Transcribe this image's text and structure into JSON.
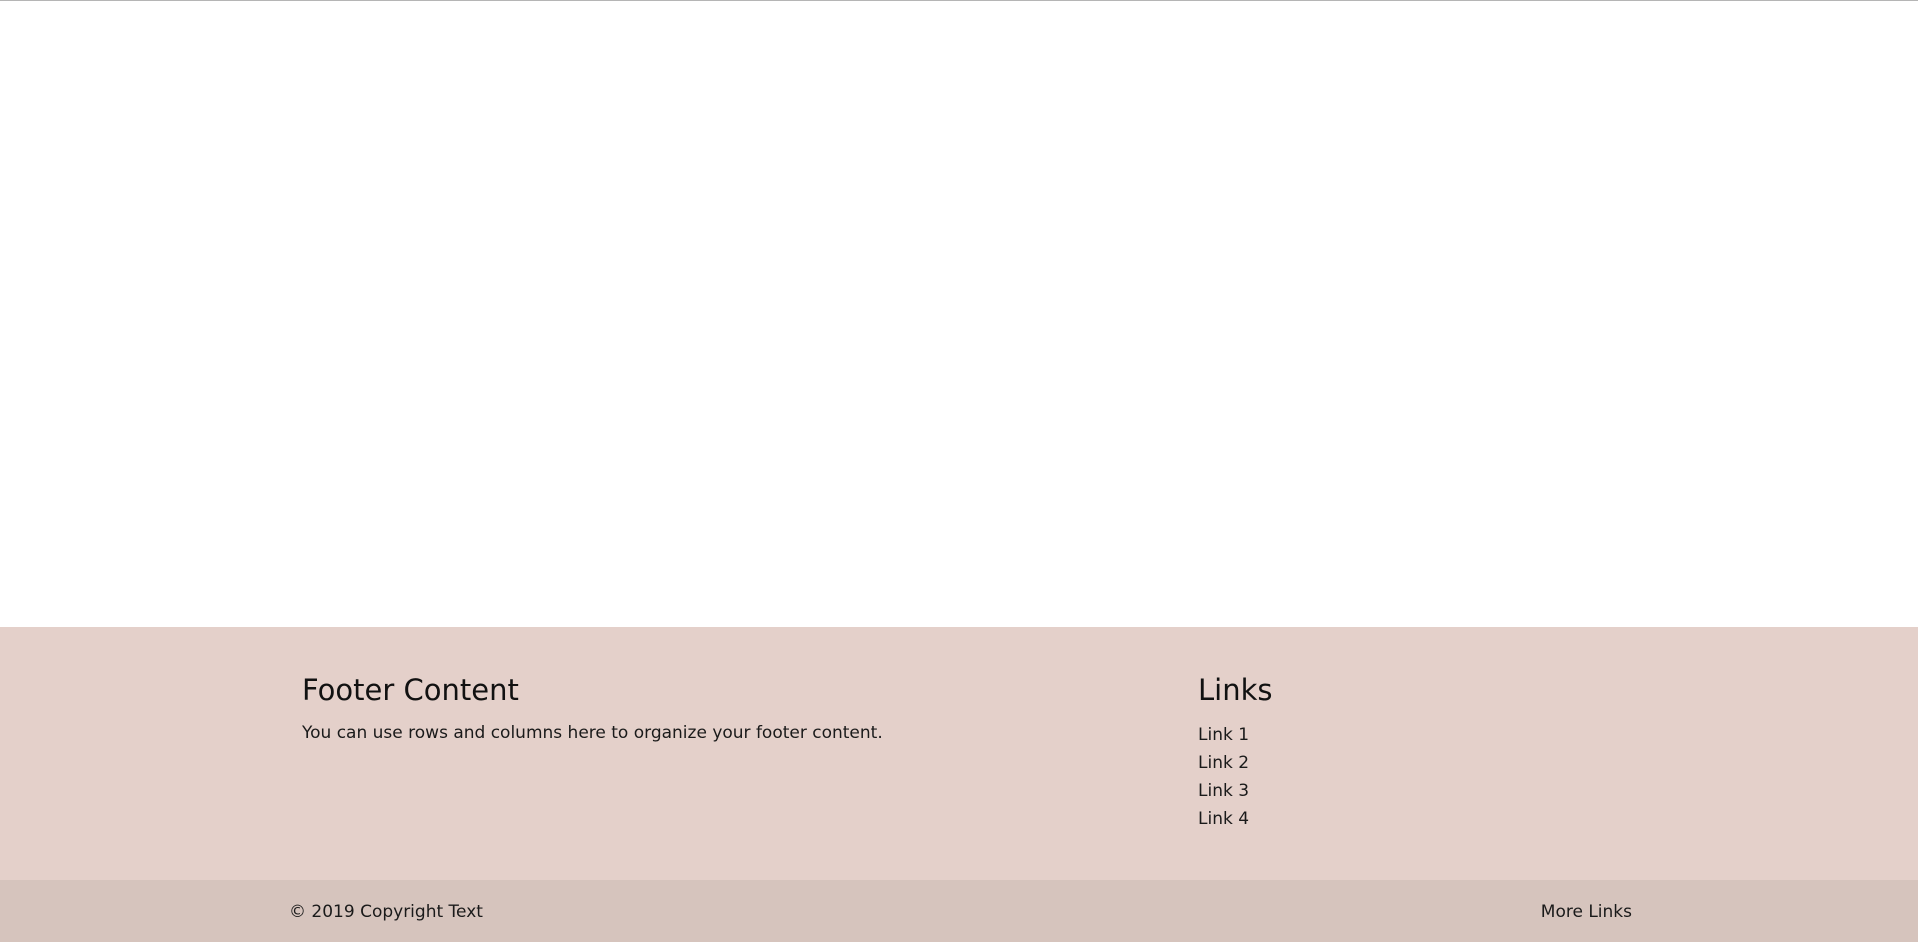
{
  "footer": {
    "content_heading": "Footer Content",
    "content_text": "You can use rows and columns here to organize your footer content.",
    "links_heading": "Links",
    "links": [
      {
        "label": "Link 1"
      },
      {
        "label": "Link 2"
      },
      {
        "label": "Link 3"
      },
      {
        "label": "Link 4"
      }
    ],
    "copyright": "© 2019 Copyright Text",
    "more_links": "More Links"
  },
  "colors": {
    "page_background": "#ffffff",
    "footer_background": "#e4d0ca",
    "footer_bottom_background": "#d6c4bd",
    "text": "#1a1a1a"
  }
}
